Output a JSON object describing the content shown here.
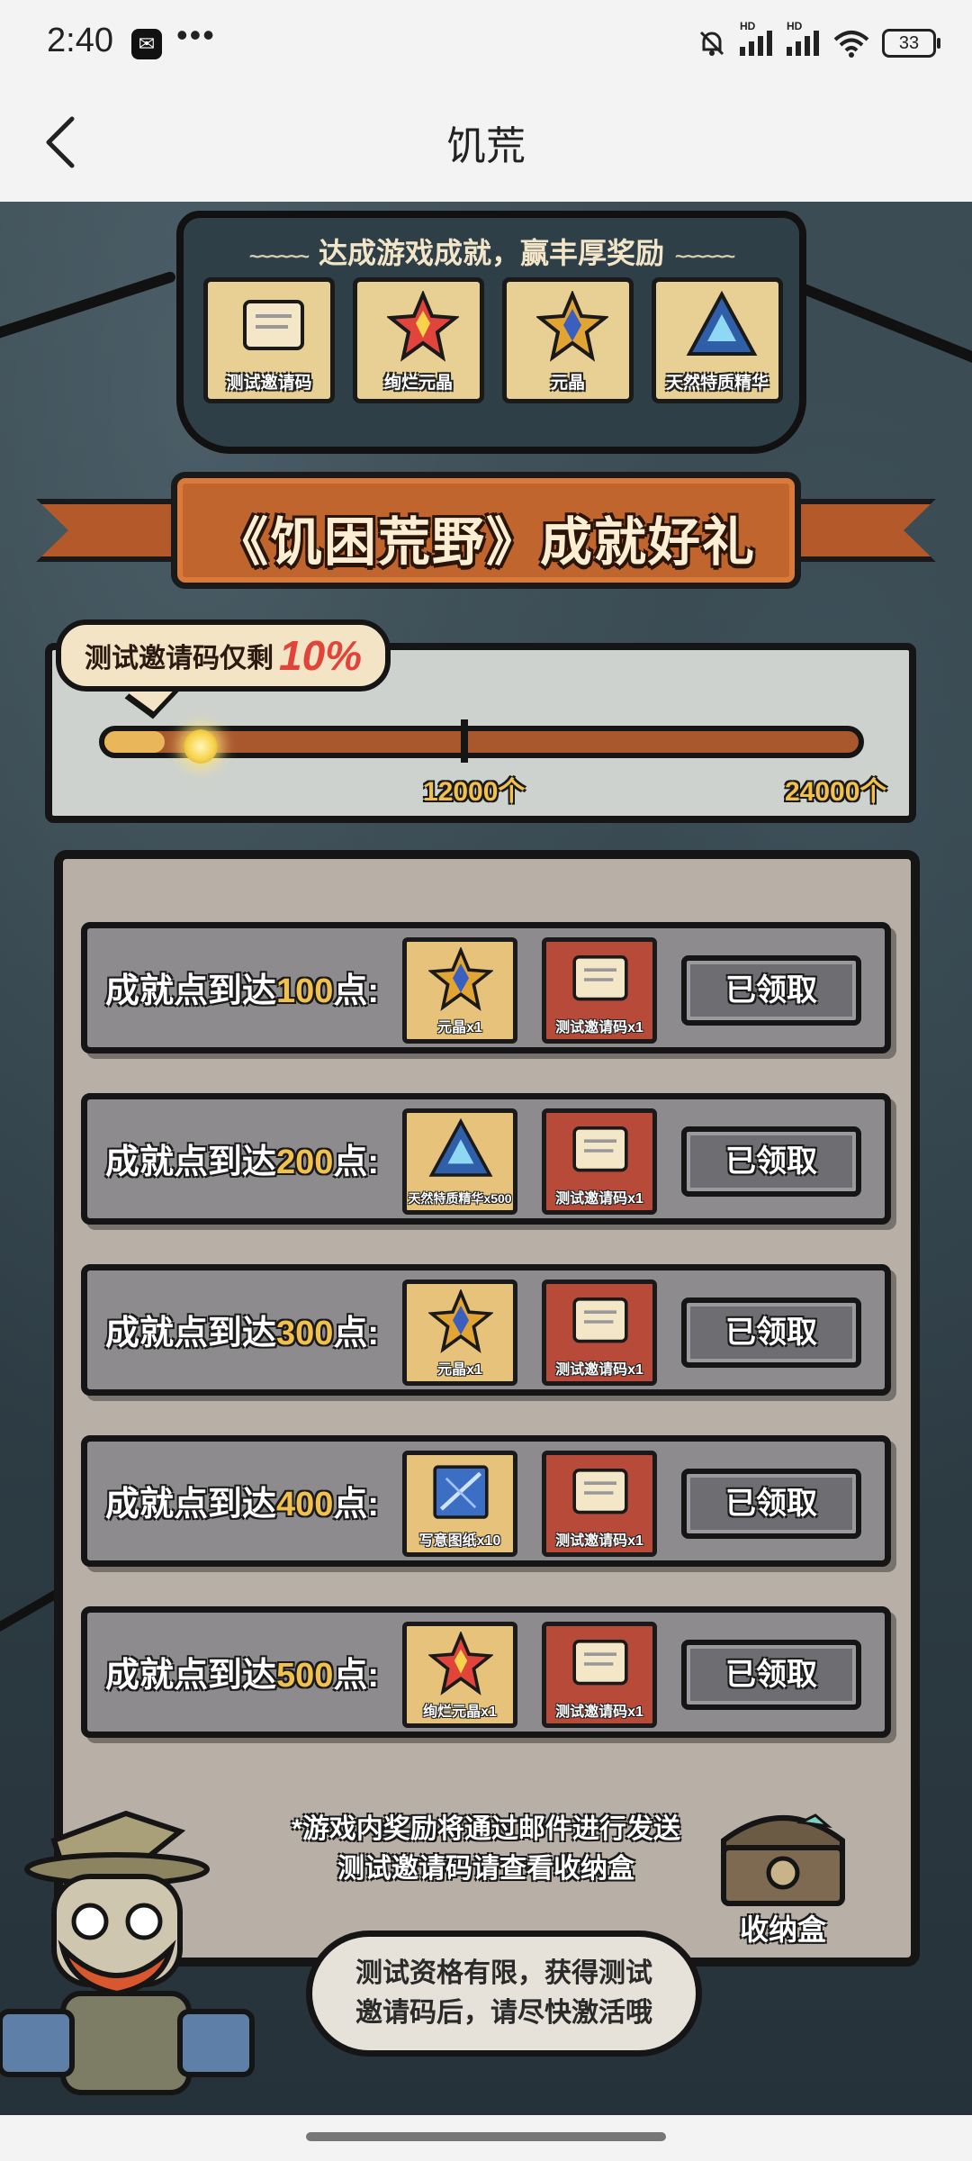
{
  "status": {
    "time": "2:40",
    "app_icon_glyph": "✉",
    "more": "•••",
    "hd1": "HD",
    "hd2": "HD",
    "battery": "33"
  },
  "header": {
    "title": "饥荒"
  },
  "rewards": {
    "heading": "达成游戏成就，赢丰厚奖励",
    "items": [
      {
        "label": "测试邀请码",
        "icon": "scroll-icon"
      },
      {
        "label": "绚烂元晶",
        "icon": "brilliant-crystal-icon"
      },
      {
        "label": "元晶",
        "icon": "star-crystal-icon"
      },
      {
        "label": "天然特质精华",
        "icon": "blue-gem-icon"
      }
    ]
  },
  "banner": {
    "title": "《饥困荒野》成就好礼"
  },
  "progress": {
    "bubble_text": "测试邀请码仅剩",
    "bubble_percent": "10%",
    "fill_fraction": 0.08,
    "mid_label": "12000个",
    "end_label": "24000个"
  },
  "achievements": {
    "label_prefix": "成就点到达",
    "label_suffix": "点:",
    "rows": [
      {
        "points": "100",
        "item1": "元晶x1",
        "item1_icon": "star-crystal-icon",
        "item2": "测试邀请码x1",
        "button": "已领取"
      },
      {
        "points": "200",
        "item1": "天然特质精华x500",
        "item1_icon": "blue-gem-icon",
        "item2": "测试邀请码x1",
        "button": "已领取"
      },
      {
        "points": "300",
        "item1": "元晶x1",
        "item1_icon": "star-crystal-icon",
        "item2": "测试邀请码x1",
        "button": "已领取"
      },
      {
        "points": "400",
        "item1": "写意图纸x10",
        "item1_icon": "blueprint-icon",
        "item2": "测试邀请码x1",
        "button": "已领取"
      },
      {
        "points": "500",
        "item1": "绚烂元晶x1",
        "item1_icon": "brilliant-crystal-icon",
        "item2": "测试邀请码x1",
        "button": "已领取"
      }
    ]
  },
  "note": {
    "line1": "*游戏内奖励将通过邮件进行发送",
    "line2": "测试邀请码请查看收纳盒"
  },
  "storage": {
    "label": "收纳盒"
  },
  "speech": {
    "line1": "测试资格有限，获得测试",
    "line2": "邀请码后，请尽快激活哦"
  }
}
